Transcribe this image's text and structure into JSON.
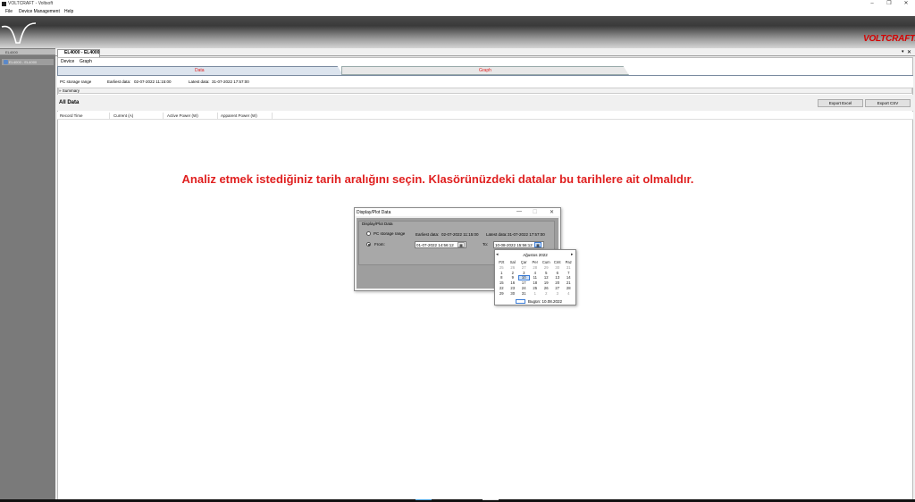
{
  "window": {
    "title": "VOLTCRAFT - Voltsoft",
    "minimize": "–",
    "restore": "❐",
    "close": "✕"
  },
  "menu": [
    "File",
    "Device Management",
    "Help"
  ],
  "brand": "VOLTCRAFT.",
  "left_panel": {
    "header": "EL4000",
    "item": "EL4000 - EL4000"
  },
  "doc_tab": {
    "label": "EL4000 - EL4000",
    "pin": "▾",
    "close": "✕"
  },
  "subtabs": [
    "Device",
    "Graph"
  ],
  "main_tabs": {
    "data": "Data",
    "graph": "Graph"
  },
  "range": {
    "label": "PC storage range",
    "earliest_label": "Earliest data:",
    "earliest_value": "02-07-2022 11:15:00",
    "latest_label": "Latest data:",
    "latest_value": "31-07-2022 17:57:00"
  },
  "summary": "Summary",
  "summary_toggle": "»",
  "all_data": {
    "title": "All Data",
    "export_excel": "Export Excel",
    "export_csv": "Export CSV",
    "columns": [
      "Record Time",
      "Current (A)",
      "Active Power (W)",
      "Apparent Power (W)"
    ]
  },
  "annotation": "Analiz etmek istediğiniz tarih aralığını seçin. Klasörünüzdeki datalar bu tarihlere ait olmalıdır.",
  "dialog": {
    "title": "Display/Plot Data",
    "group_title": "Display/Plot Data",
    "radio_storage": "PC storage range",
    "earliest_label": "Earliest data:",
    "earliest_value": "02-07-2022 11:15:00",
    "latest_label": "Latest data:",
    "latest_value": "31-07-2022 17:57:00",
    "radio_from": "From:",
    "from_value": "01-07-2022 14:56:12",
    "to_label": "To:",
    "to_value": "10-08-2022 15:56:12",
    "minimize": "—",
    "maximize": "☐",
    "close": "✕"
  },
  "calendar": {
    "month": "Ağustos 2022",
    "prev": "◂",
    "next": "▸",
    "weekdays": [
      "Pzt",
      "Sal",
      "Çar",
      "Per",
      "Cum",
      "Cmt",
      "Paz"
    ],
    "weeks": [
      [
        "25",
        "26",
        "27",
        "28",
        "29",
        "30",
        "31"
      ],
      [
        "1",
        "2",
        "3",
        "4",
        "5",
        "6",
        "7"
      ],
      [
        "8",
        "9",
        "10",
        "11",
        "12",
        "13",
        "14"
      ],
      [
        "15",
        "16",
        "17",
        "18",
        "19",
        "20",
        "21"
      ],
      [
        "22",
        "23",
        "24",
        "25",
        "26",
        "27",
        "28"
      ],
      [
        "29",
        "30",
        "31",
        "1",
        "2",
        "3",
        "4"
      ]
    ],
    "selected_day": "10",
    "today": "Bugün: 10.08.2022"
  },
  "colors": {
    "accent_red": "#e02020",
    "brand_red": "#d40000",
    "selection_blue": "#3a7bd5"
  }
}
